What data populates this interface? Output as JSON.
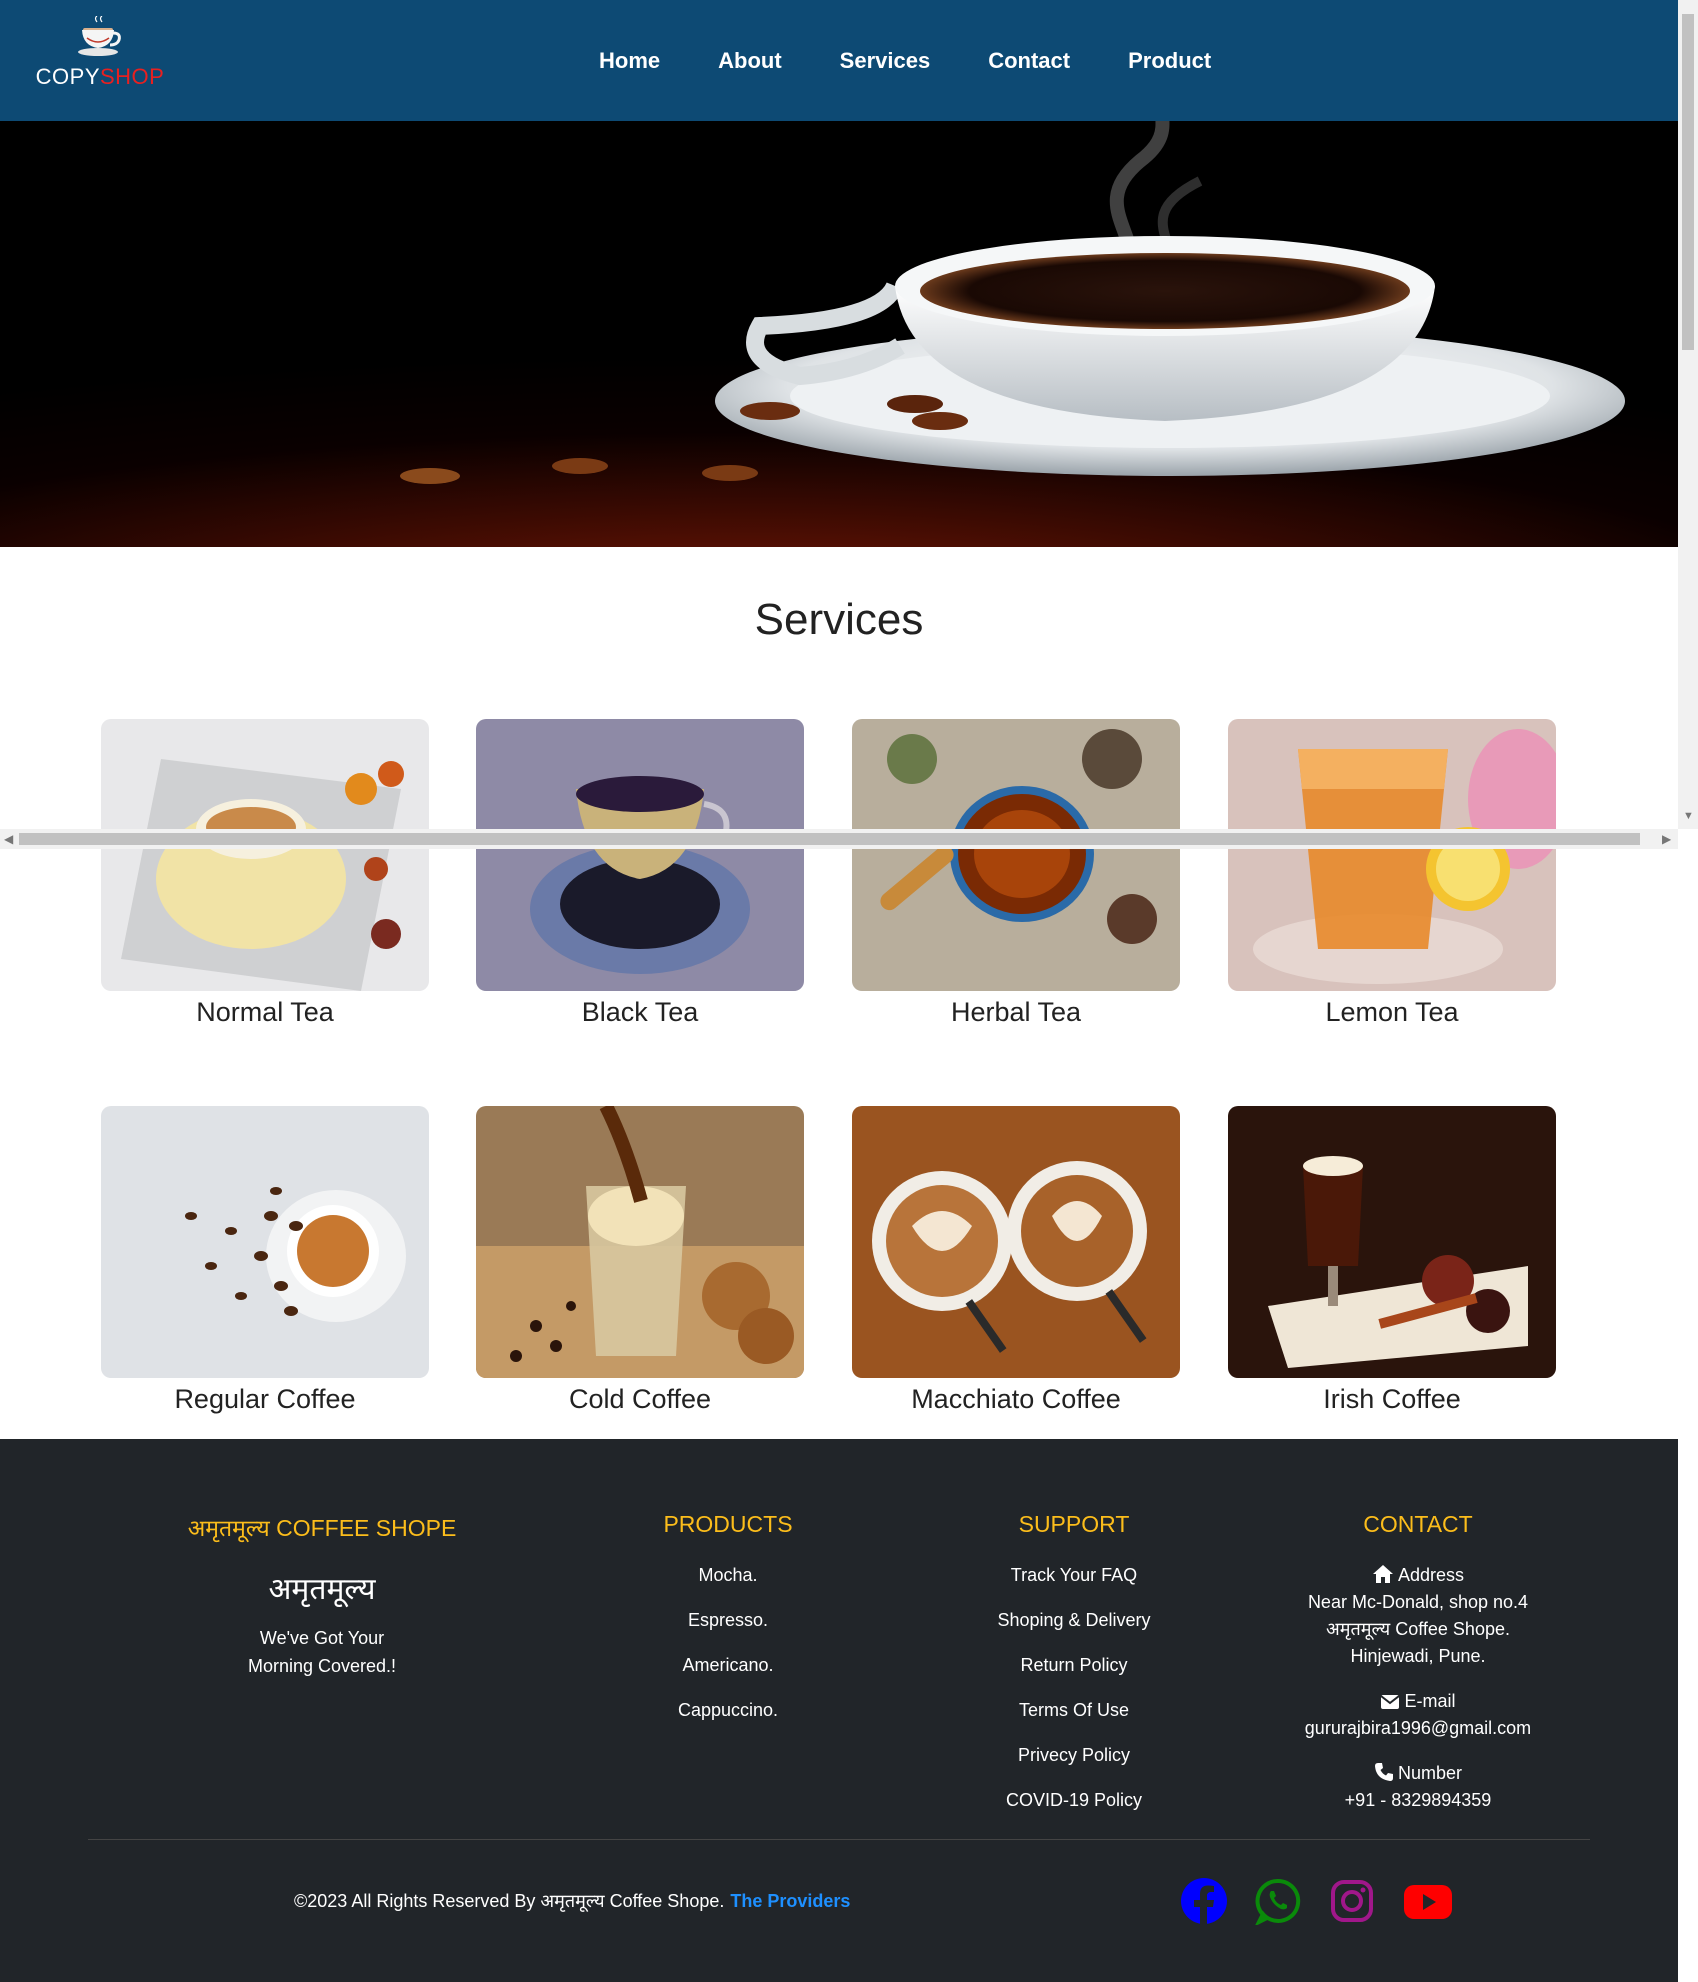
{
  "nav": {
    "logo_text_primary": "COPY",
    "logo_text_accent": "SHOP",
    "logo_icon": "coffee-cup-icon",
    "links": [
      "Home",
      "About",
      "Services",
      "Contact",
      "Product"
    ]
  },
  "services": {
    "title": "Services",
    "items": [
      {
        "label": "Normal Tea",
        "image": "normal-tea-image"
      },
      {
        "label": "Black Tea",
        "image": "black-tea-image"
      },
      {
        "label": "Herbal Tea",
        "image": "herbal-tea-image"
      },
      {
        "label": "Lemon Tea",
        "image": "lemon-tea-image"
      },
      {
        "label": "Regular Coffee",
        "image": "regular-coffee-image"
      },
      {
        "label": "Cold Coffee",
        "image": "cold-coffee-image"
      },
      {
        "label": "Macchiato Coffee",
        "image": "macchiato-coffee-image"
      },
      {
        "label": "Irish Coffee",
        "image": "irish-coffee-image"
      }
    ]
  },
  "footer": {
    "brand": {
      "heading": "अमृतमूल्य COFFEE SHOPE",
      "name": "अमृतमूल्य",
      "tagline_1": "We've Got Your",
      "tagline_2": "Morning Covered.!"
    },
    "products": {
      "heading": "PRODUCTS",
      "items": [
        "Mocha.",
        "Espresso.",
        "Americano.",
        "Cappuccino."
      ]
    },
    "support": {
      "heading": "SUPPORT",
      "items": [
        "Track Your FAQ",
        "Shoping & Delivery",
        "Return Policy",
        "Terms Of Use",
        "Privecy Policy",
        "COVID-19 Policy"
      ]
    },
    "contact": {
      "heading": "CONTACT",
      "address_label": "Address",
      "address_line_1": "Near Mc-Donald, shop no.4",
      "address_line_2": "अमृतमूल्य Coffee Shope.",
      "address_line_3": "Hinjewadi, Pune.",
      "email_label": "E-mail",
      "email": "gururajbira1996@gmail.com",
      "phone_label": "Number",
      "phone": "+91 - 8329894359"
    },
    "copyright": "©2023 All Rights Reserved By अमृतमूल्य Coffee Shope.",
    "providers": "The Providers",
    "social": [
      "facebook-icon",
      "whatsapp-icon",
      "instagram-icon",
      "youtube-icon"
    ]
  },
  "colors": {
    "navbar_bg": "#0d4a74",
    "footer_bg": "#212529",
    "footer_heading": "#fcbd1b",
    "logo_accent": "#e82020",
    "providers_link": "#1e90ff",
    "facebook": "#0000ff",
    "whatsapp": "#0a8a0a",
    "instagram": "#a0178a",
    "youtube": "#ff0000"
  }
}
